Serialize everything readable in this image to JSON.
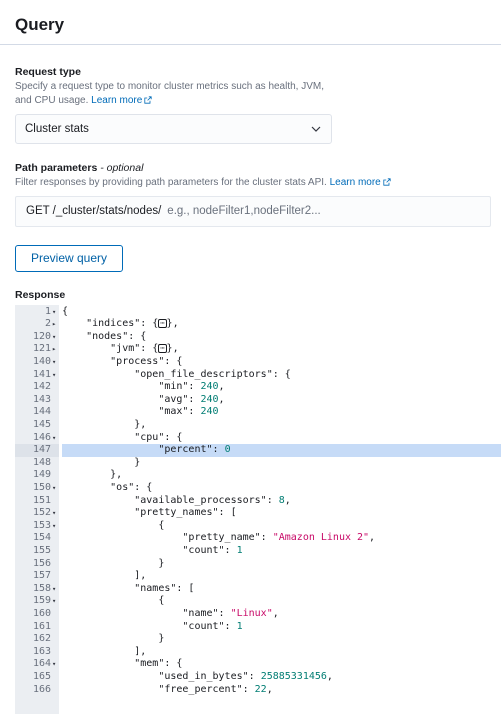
{
  "page": {
    "title": "Query"
  },
  "request_type": {
    "label": "Request type",
    "help": "Specify a request type to monitor cluster metrics such as health, JVM, and CPU usage.",
    "learn_more": "Learn more",
    "selected": "Cluster stats"
  },
  "path_params": {
    "label": "Path parameters",
    "optional": "- optional",
    "help": "Filter responses by providing path parameters for the cluster stats API.",
    "learn_more": "Learn more",
    "prefix": "GET /_cluster/stats/nodes/",
    "placeholder": "e.g., nodeFilter1,nodeFilter2..."
  },
  "preview_button": "Preview query",
  "response": {
    "label": "Response",
    "active_line": 147,
    "lines": [
      {
        "n": "1",
        "fold": "▾",
        "code": [
          [
            "p",
            "{"
          ]
        ]
      },
      {
        "n": "2",
        "fold": "▸",
        "code": [
          [
            "p",
            "    \"indices\": {"
          ],
          [
            "c",
            "⋯"
          ],
          [
            "p",
            "},"
          ]
        ]
      },
      {
        "n": "120",
        "fold": "▾",
        "code": [
          [
            "p",
            "    \"nodes\": {"
          ]
        ]
      },
      {
        "n": "121",
        "fold": "▸",
        "code": [
          [
            "p",
            "        \"jvm\": {"
          ],
          [
            "c",
            "⋯"
          ],
          [
            "p",
            "},"
          ]
        ]
      },
      {
        "n": "140",
        "fold": "▾",
        "code": [
          [
            "p",
            "        \"process\": {"
          ]
        ]
      },
      {
        "n": "141",
        "fold": "▾",
        "code": [
          [
            "p",
            "            \"open_file_descriptors\": {"
          ]
        ]
      },
      {
        "n": "142",
        "fold": "",
        "code": [
          [
            "p",
            "                \"min\": "
          ],
          [
            "n",
            "240"
          ],
          [
            "p",
            ","
          ]
        ]
      },
      {
        "n": "143",
        "fold": "",
        "code": [
          [
            "p",
            "                \"avg\": "
          ],
          [
            "n",
            "240"
          ],
          [
            "p",
            ","
          ]
        ]
      },
      {
        "n": "144",
        "fold": "",
        "code": [
          [
            "p",
            "                \"max\": "
          ],
          [
            "n",
            "240"
          ]
        ]
      },
      {
        "n": "145",
        "fold": "",
        "code": [
          [
            "p",
            "            },"
          ]
        ]
      },
      {
        "n": "146",
        "fold": "▾",
        "code": [
          [
            "p",
            "            \"cpu\": {"
          ]
        ]
      },
      {
        "n": "147",
        "fold": "",
        "code": [
          [
            "p",
            "                \"percent\": "
          ],
          [
            "n",
            "0"
          ]
        ]
      },
      {
        "n": "148",
        "fold": "",
        "code": [
          [
            "p",
            "            }"
          ]
        ]
      },
      {
        "n": "149",
        "fold": "",
        "code": [
          [
            "p",
            "        },"
          ]
        ]
      },
      {
        "n": "150",
        "fold": "▾",
        "code": [
          [
            "p",
            "        \"os\": {"
          ]
        ]
      },
      {
        "n": "151",
        "fold": "",
        "code": [
          [
            "p",
            "            \"available_processors\": "
          ],
          [
            "n",
            "8"
          ],
          [
            "p",
            ","
          ]
        ]
      },
      {
        "n": "152",
        "fold": "▾",
        "code": [
          [
            "p",
            "            \"pretty_names\": ["
          ]
        ]
      },
      {
        "n": "153",
        "fold": "▾",
        "code": [
          [
            "p",
            "                {"
          ]
        ]
      },
      {
        "n": "154",
        "fold": "",
        "code": [
          [
            "p",
            "                    \"pretty_name\": "
          ],
          [
            "s",
            "\"Amazon Linux 2\""
          ],
          [
            "p",
            ","
          ]
        ]
      },
      {
        "n": "155",
        "fold": "",
        "code": [
          [
            "p",
            "                    \"count\": "
          ],
          [
            "n",
            "1"
          ]
        ]
      },
      {
        "n": "156",
        "fold": "",
        "code": [
          [
            "p",
            "                }"
          ]
        ]
      },
      {
        "n": "157",
        "fold": "",
        "code": [
          [
            "p",
            "            ],"
          ]
        ]
      },
      {
        "n": "158",
        "fold": "▾",
        "code": [
          [
            "p",
            "            \"names\": ["
          ]
        ]
      },
      {
        "n": "159",
        "fold": "▾",
        "code": [
          [
            "p",
            "                {"
          ]
        ]
      },
      {
        "n": "160",
        "fold": "",
        "code": [
          [
            "p",
            "                    \"name\": "
          ],
          [
            "s",
            "\"Linux\""
          ],
          [
            "p",
            ","
          ]
        ]
      },
      {
        "n": "161",
        "fold": "",
        "code": [
          [
            "p",
            "                    \"count\": "
          ],
          [
            "n",
            "1"
          ]
        ]
      },
      {
        "n": "162",
        "fold": "",
        "code": [
          [
            "p",
            "                }"
          ]
        ]
      },
      {
        "n": "163",
        "fold": "",
        "code": [
          [
            "p",
            "            ],"
          ]
        ]
      },
      {
        "n": "164",
        "fold": "▾",
        "code": [
          [
            "p",
            "            \"mem\": {"
          ]
        ]
      },
      {
        "n": "165",
        "fold": "",
        "code": [
          [
            "p",
            "                \"used_in_bytes\": "
          ],
          [
            "n",
            "25885331456"
          ],
          [
            "p",
            ","
          ]
        ]
      },
      {
        "n": "166",
        "fold": "",
        "code": [
          [
            "p",
            "                \"free_percent\": "
          ],
          [
            "n",
            "22"
          ],
          [
            "p",
            ","
          ]
        ]
      }
    ]
  },
  "colors": {
    "accent": "#006bb8",
    "highlight": "#c6dbf7",
    "string": "#c80a68",
    "number": "#017d73"
  },
  "icons": {
    "external_link": "external-link-icon",
    "select_arrow": "chevron-down-icon"
  }
}
